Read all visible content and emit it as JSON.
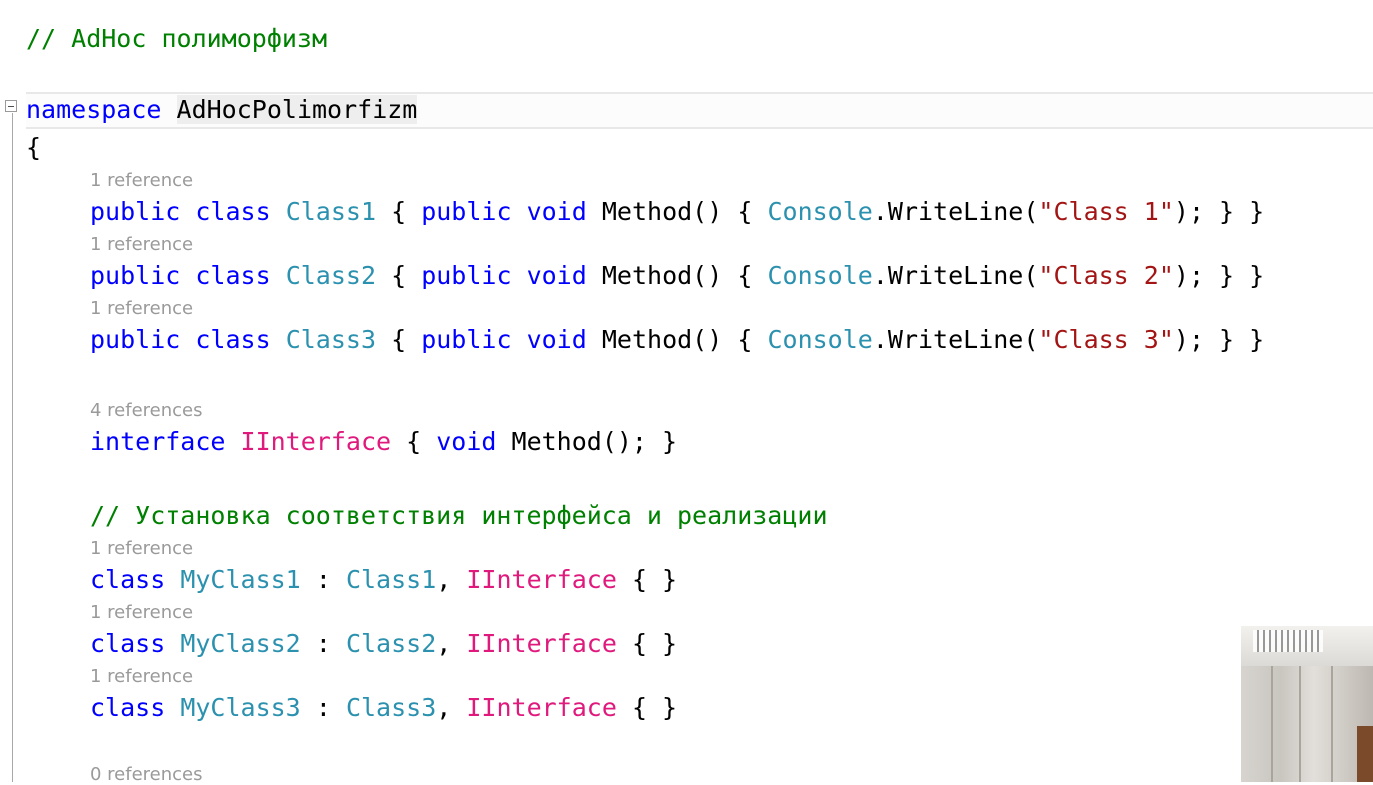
{
  "editor": {
    "top_comment": "// AdHoc полиморфизм",
    "namespace_keyword": "namespace",
    "namespace_name": "AdHocPolimorfizm",
    "open_brace": "{",
    "lens": {
      "class1": "1 reference",
      "class2": "1 reference",
      "class3": "1 reference",
      "iinterface": "4 references",
      "myclass1": "1 reference",
      "myclass2": "1 reference",
      "myclass3": "1 reference",
      "last": "0 references"
    },
    "tokens": {
      "public": "public",
      "class": "class",
      "void": "void",
      "interface": "interface",
      "method": "Method",
      "console": "Console",
      "writeline": "WriteLine",
      "iinterface": "IInterface",
      "class1": "Class1",
      "class2": "Class2",
      "class3": "Class3",
      "myclass1": "MyClass1",
      "myclass2": "MyClass2",
      "myclass3": "MyClass3",
      "str1": "\"Class 1\"",
      "str2": "\"Class 2\"",
      "str3": "\"Class 3\""
    },
    "comment_mapping": "// Установка соответствия интерфейса и реализации"
  },
  "colors": {
    "keyword": "#0000ff",
    "type": "#2b91af",
    "interface": "#e0197d",
    "string": "#a31515",
    "comment": "#008000",
    "codelens": "#9a9a9a"
  },
  "icons": {
    "collapse": "minus-box-icon"
  }
}
